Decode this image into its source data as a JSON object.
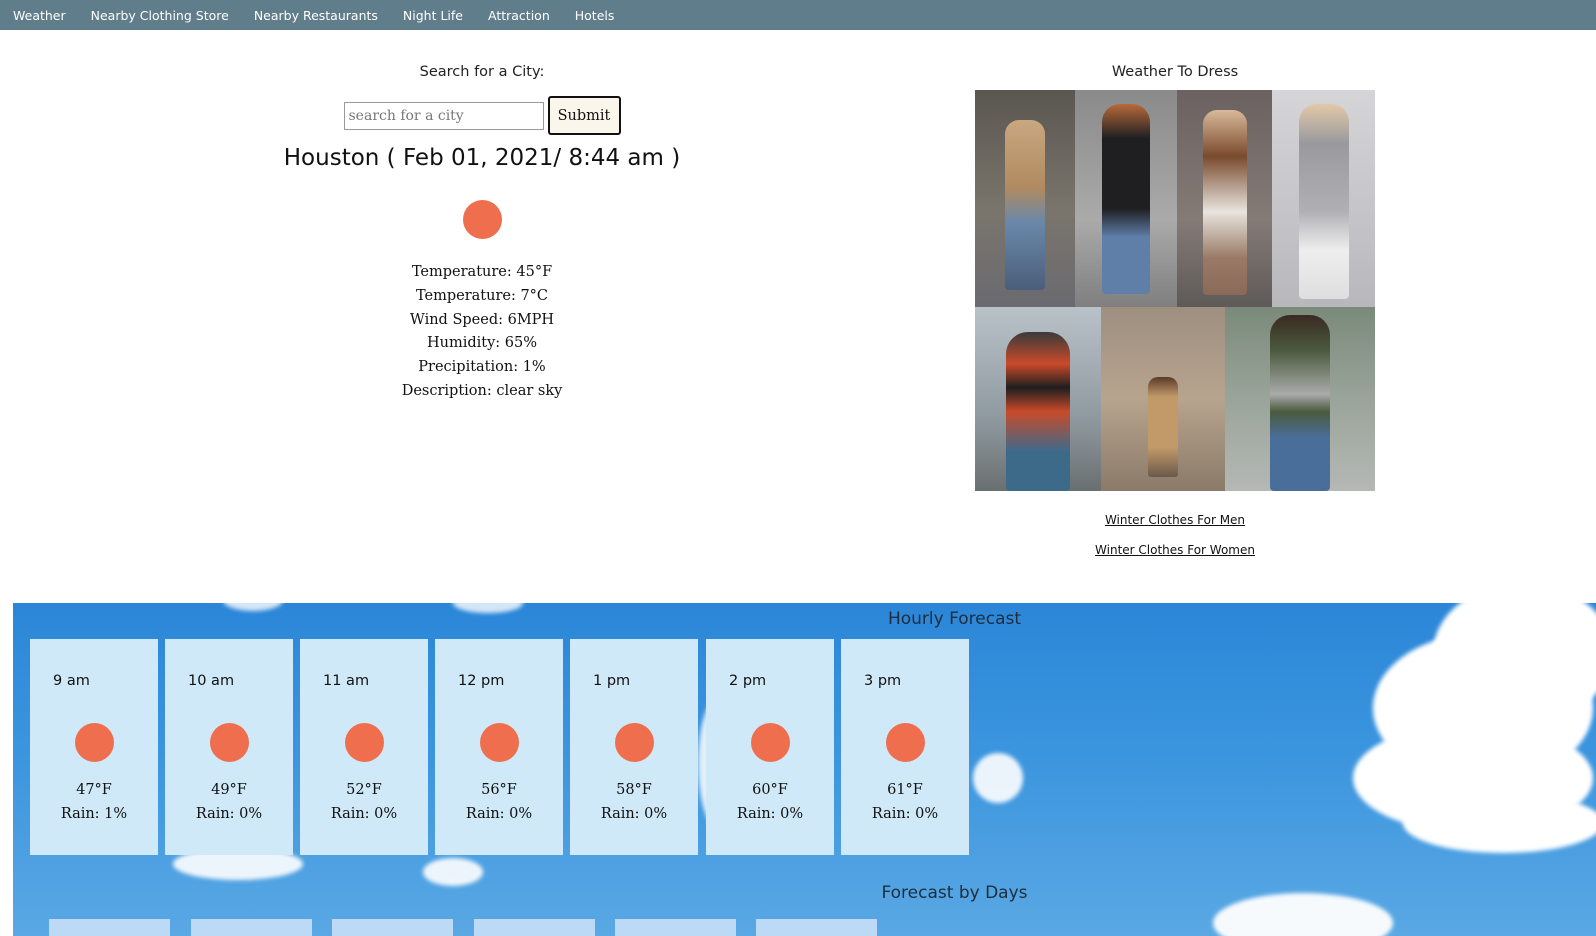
{
  "nav": {
    "items": [
      "Weather",
      "Nearby Clothing Store",
      "Nearby Restaurants",
      "Night Life",
      "Attraction",
      "Hotels"
    ]
  },
  "search": {
    "label": "Search for a City:",
    "placeholder": "search for a city",
    "value": "",
    "submit_label": "Submit"
  },
  "current": {
    "title": "Houston ( Feb 01, 2021/ 8:44 am )",
    "icon": "sun-icon",
    "details": [
      "Temperature: 45°F",
      "Temperature: 7°C",
      "Wind Speed: 6MPH",
      "Humidity: 65%",
      "Precipitation: 1%",
      "Description: clear sky"
    ]
  },
  "dress": {
    "title": "Weather To Dress",
    "links": [
      "Winter Clothes For Men",
      "Winter Clothes For Women"
    ]
  },
  "hourly": {
    "title": "Hourly Forecast",
    "cards": [
      {
        "time": "9 am",
        "temp": "47°F",
        "rain": "Rain: 1%"
      },
      {
        "time": "10 am",
        "temp": "49°F",
        "rain": "Rain: 0%"
      },
      {
        "time": "11 am",
        "temp": "52°F",
        "rain": "Rain: 0%"
      },
      {
        "time": "12 pm",
        "temp": "56°F",
        "rain": "Rain: 0%"
      },
      {
        "time": "1 pm",
        "temp": "58°F",
        "rain": "Rain: 0%"
      },
      {
        "time": "2 pm",
        "temp": "60°F",
        "rain": "Rain: 0%"
      },
      {
        "time": "3 pm",
        "temp": "61°F",
        "rain": "Rain: 0%"
      }
    ]
  },
  "days": {
    "title": "Forecast by Days"
  },
  "colors": {
    "nav_bg": "#607d8b",
    "sun": "#ee6e4e",
    "card_bg": "#d0e9f8",
    "sky": "#2b86d8"
  }
}
